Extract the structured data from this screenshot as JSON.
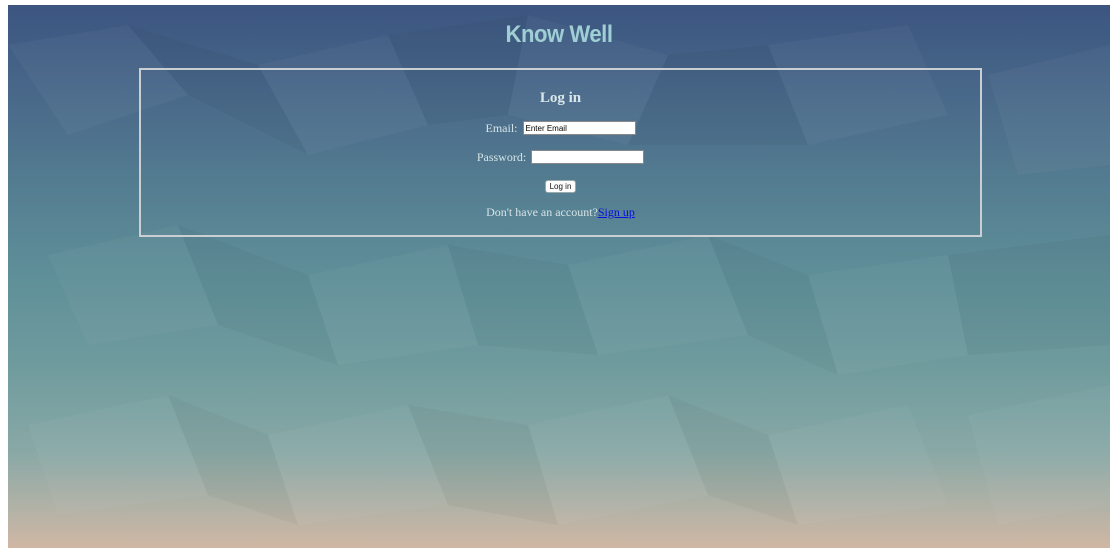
{
  "app": {
    "title": "Know Well"
  },
  "login": {
    "heading": "Log in",
    "email_label": "Email:",
    "email_placeholder": "Enter Email",
    "email_value": "",
    "password_label": "Password:",
    "password_value": "",
    "submit_label": "Log in",
    "signup_prompt": "Don't have an account?",
    "signup_link": "Sign up"
  },
  "colors": {
    "background_top": "#3b5580",
    "background_bottom": "#d0b7a4",
    "title": "#9fcfd5",
    "box_border": "#c9cfd3",
    "link": "#0a0ee0"
  }
}
